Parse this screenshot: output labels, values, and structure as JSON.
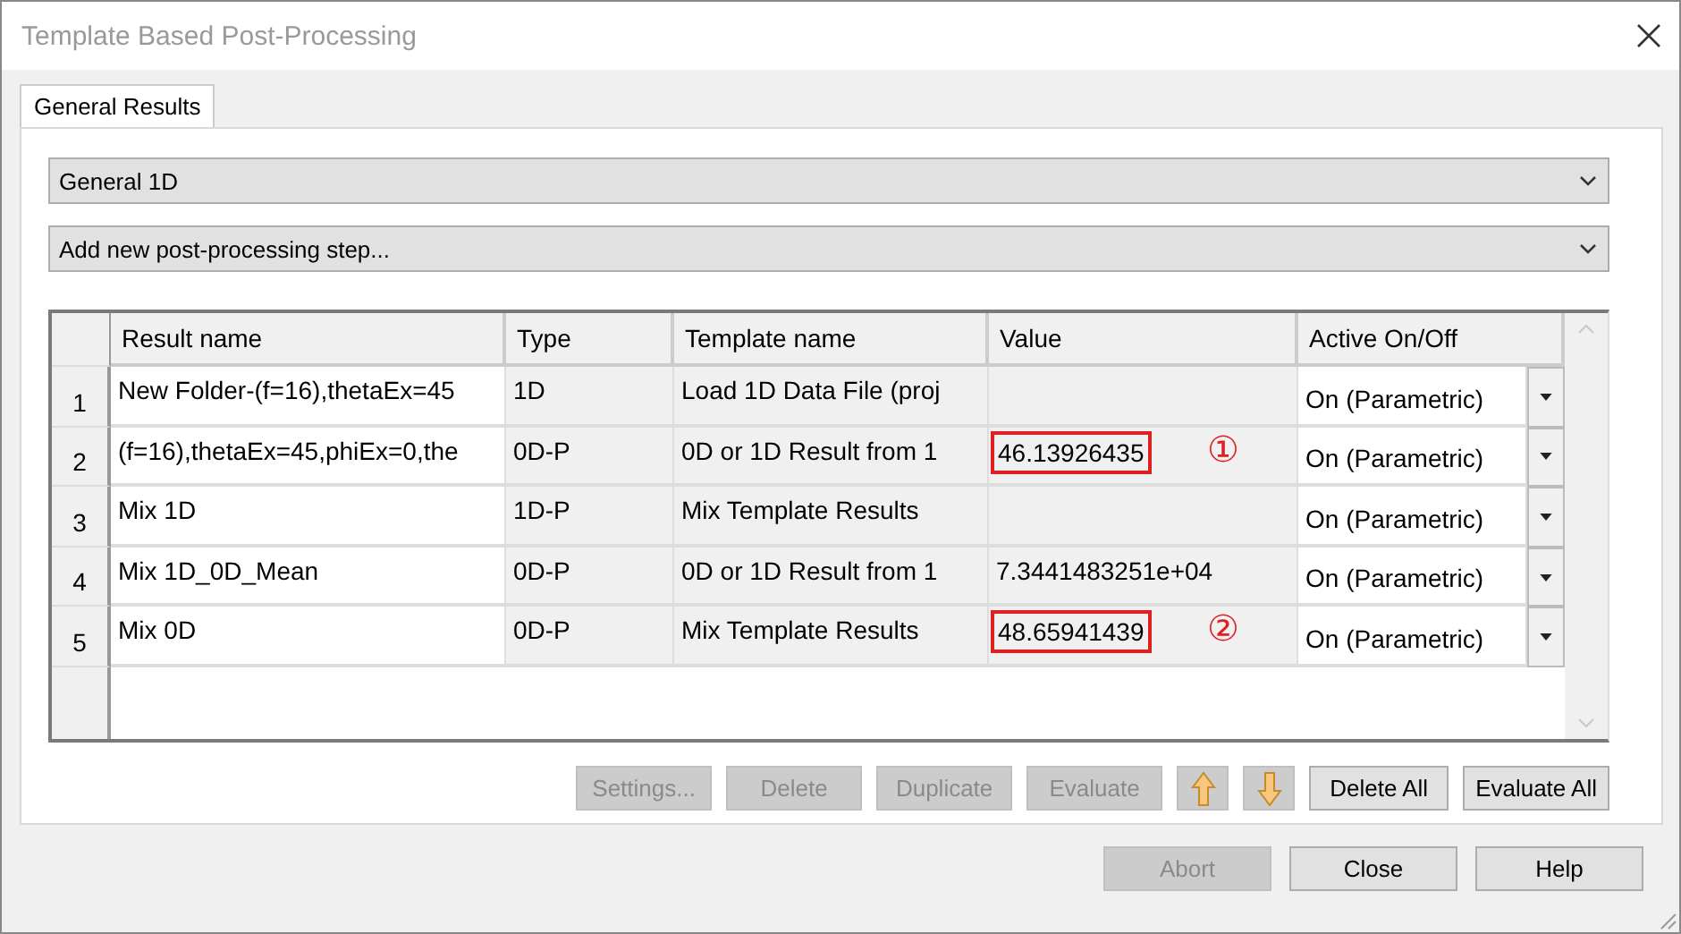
{
  "window": {
    "title": "Template Based Post-Processing"
  },
  "tabs": [
    {
      "label": "General Results",
      "selected": true
    }
  ],
  "dropdowns": [
    {
      "value": "General 1D"
    },
    {
      "value": "Add new post-processing step..."
    }
  ],
  "table": {
    "columns": [
      "Result name",
      "Type",
      "Template name",
      "Value",
      "Active On/Off"
    ],
    "rows": [
      {
        "index": "1",
        "result_name": "New Folder-(f=16),thetaEx=45",
        "type": "1D",
        "template_name": "Load 1D Data File (proj",
        "value": "",
        "highlighted": false,
        "callout": "",
        "active": "On (Parametric)"
      },
      {
        "index": "2",
        "result_name": "(f=16),thetaEx=45,phiEx=0,the",
        "type": "0D-P",
        "template_name": "0D or 1D Result from 1",
        "value": "46.13926435",
        "highlighted": true,
        "callout": "①",
        "active": "On (Parametric)"
      },
      {
        "index": "3",
        "result_name": "Mix 1D",
        "type": "1D-P",
        "template_name": "Mix Template Results",
        "value": "",
        "highlighted": false,
        "callout": "",
        "active": "On (Parametric)"
      },
      {
        "index": "4",
        "result_name": "Mix 1D_0D_Mean",
        "type": "0D-P",
        "template_name": "0D or 1D Result from 1",
        "value": "7.3441483251e+04",
        "highlighted": false,
        "callout": "",
        "active": "On (Parametric)"
      },
      {
        "index": "5",
        "result_name": "Mix 0D",
        "type": "0D-P",
        "template_name": "Mix Template Results",
        "value": "48.65941439",
        "highlighted": true,
        "callout": "②",
        "active": "On (Parametric)"
      }
    ]
  },
  "step_buttons": [
    {
      "kind": "text",
      "label": "Settings...",
      "disabled": true
    },
    {
      "kind": "text",
      "label": "Delete",
      "disabled": true
    },
    {
      "kind": "text",
      "label": "Duplicate",
      "disabled": true
    },
    {
      "kind": "text",
      "label": "Evaluate",
      "disabled": true
    },
    {
      "kind": "up",
      "disabled": true
    },
    {
      "kind": "down",
      "disabled": true
    },
    {
      "kind": "text",
      "label": "Delete All",
      "disabled": false
    },
    {
      "kind": "text",
      "label": "Evaluate All",
      "disabled": false
    }
  ],
  "dialog_buttons": [
    {
      "label": "Abort",
      "disabled": true
    },
    {
      "label": "Close",
      "disabled": false
    },
    {
      "label": "Help",
      "disabled": false
    }
  ]
}
